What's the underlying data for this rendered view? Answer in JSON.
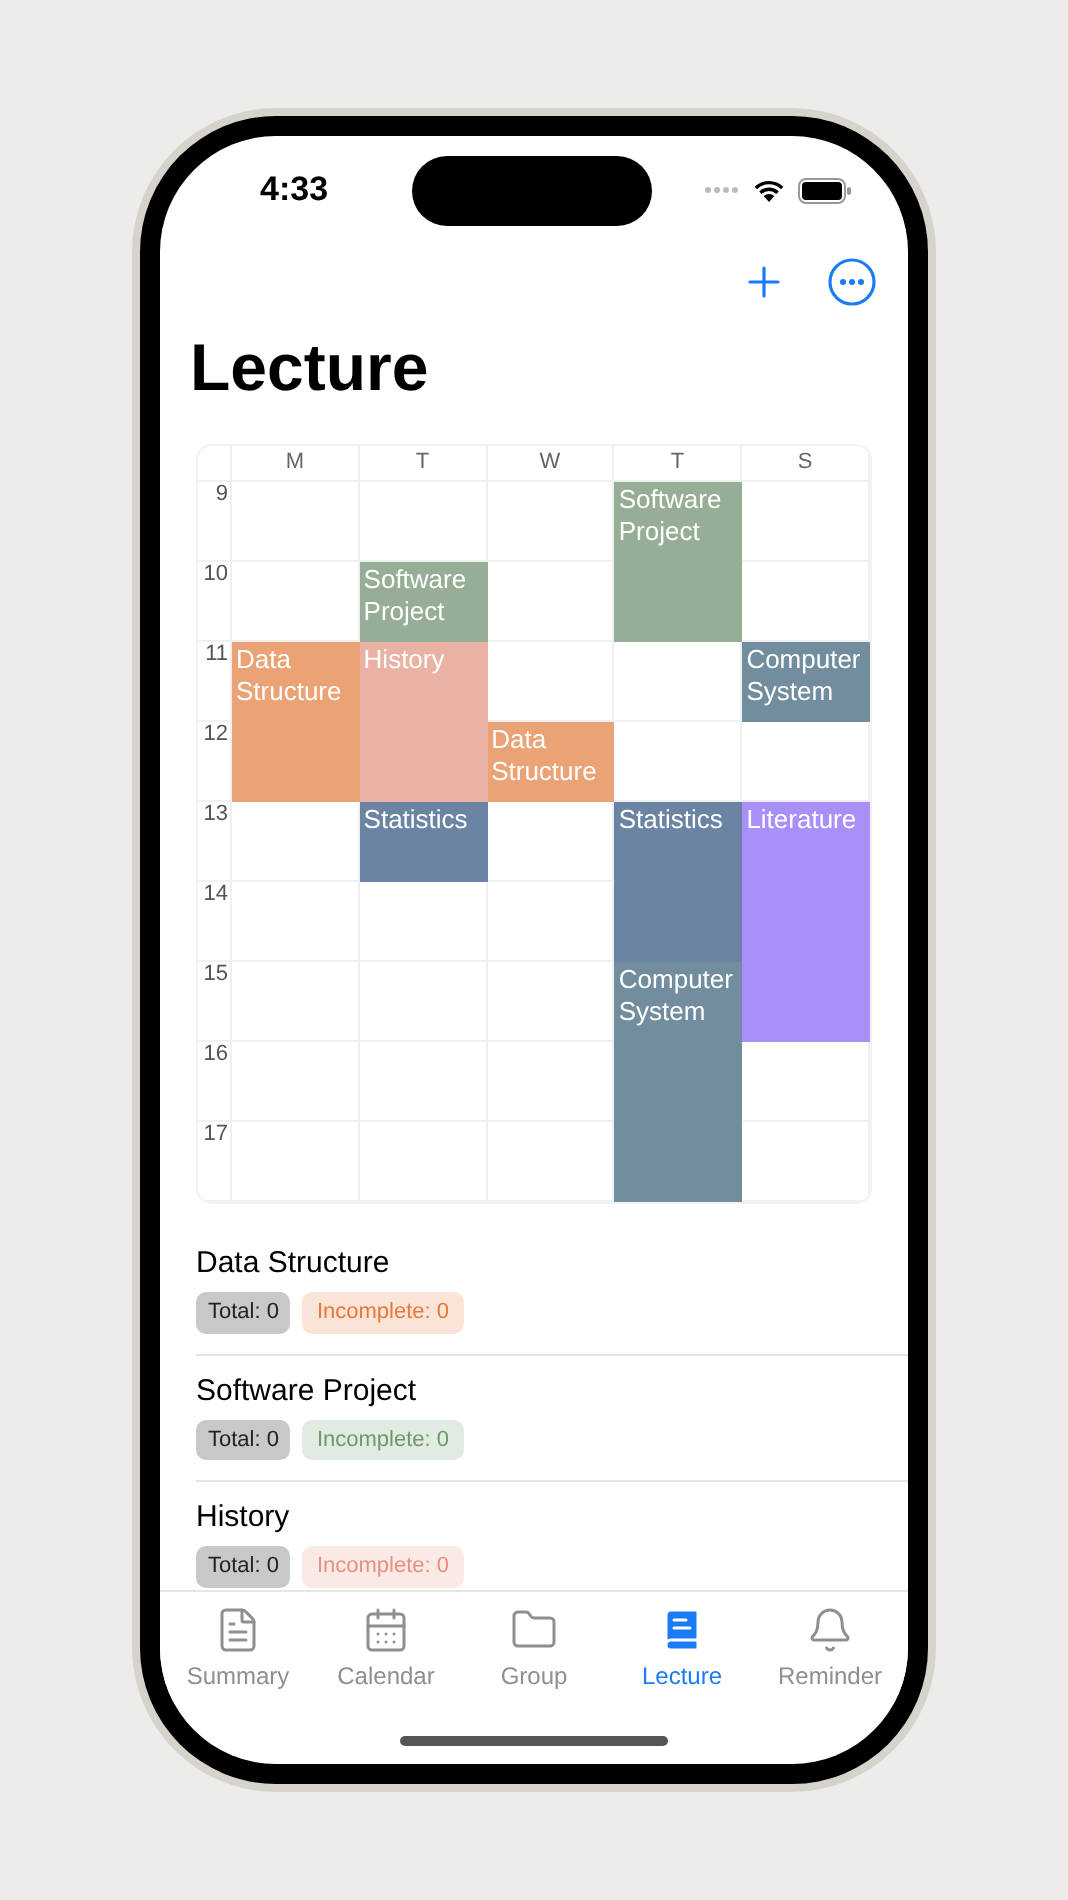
{
  "status_bar": {
    "time": "4:33"
  },
  "title": "Lecture",
  "timetable": {
    "hours": [
      "9",
      "10",
      "11",
      "12",
      "13",
      "14",
      "15",
      "16",
      "17"
    ],
    "days": [
      {
        "label": "M",
        "cells": [
          {
            "kind": "empty"
          },
          {
            "kind": "empty"
          },
          {
            "kind": "lecture",
            "title": "Data Structure",
            "color": "#eba375"
          },
          {
            "kind": "continued"
          },
          {
            "kind": "empty"
          },
          {
            "kind": "empty"
          },
          {
            "kind": "empty"
          },
          {
            "kind": "empty"
          },
          {
            "kind": "empty"
          }
        ]
      },
      {
        "label": "T",
        "cells": [
          {
            "kind": "empty"
          },
          {
            "kind": "lecture",
            "title": "Software Project",
            "color": "#96ae95"
          },
          {
            "kind": "lecture",
            "title": "History",
            "color": "#e9b2a5"
          },
          {
            "kind": "continued"
          },
          {
            "kind": "lecture",
            "title": "Statistics",
            "color": "#6c84a3"
          },
          {
            "kind": "empty"
          },
          {
            "kind": "empty"
          },
          {
            "kind": "empty"
          },
          {
            "kind": "empty"
          }
        ]
      },
      {
        "label": "W",
        "cells": [
          {
            "kind": "empty"
          },
          {
            "kind": "empty"
          },
          {
            "kind": "empty"
          },
          {
            "kind": "lecture",
            "title": "Data Structure",
            "color": "#eba375"
          },
          {
            "kind": "empty"
          },
          {
            "kind": "empty"
          },
          {
            "kind": "empty"
          },
          {
            "kind": "empty"
          },
          {
            "kind": "empty"
          }
        ]
      },
      {
        "label": "T",
        "cells": [
          {
            "kind": "lecture",
            "title": "Software Project",
            "color": "#96ae95"
          },
          {
            "kind": "continued"
          },
          {
            "kind": "empty"
          },
          {
            "kind": "empty"
          },
          {
            "kind": "lecture",
            "title": "Statistics",
            "color": "#6c84a3"
          },
          {
            "kind": "continued"
          },
          {
            "kind": "lecture",
            "title": "Computer System",
            "color": "#718d9e"
          },
          {
            "kind": "continued"
          },
          {
            "kind": "continued"
          }
        ]
      },
      {
        "label": "S",
        "cells": [
          {
            "kind": "empty"
          },
          {
            "kind": "empty"
          },
          {
            "kind": "lecture",
            "title": "Computer System",
            "color": "#718d9e"
          },
          {
            "kind": "empty"
          },
          {
            "kind": "lecture",
            "title": "Literature",
            "color": "#a98ff9"
          },
          {
            "kind": "continued"
          },
          {
            "kind": "continued"
          },
          {
            "kind": "empty"
          },
          {
            "kind": "empty"
          }
        ]
      }
    ]
  },
  "courses": [
    {
      "name": "Data Structure",
      "total": "Total: 0",
      "incomplete": "Incomplete: 0",
      "color": "#e8773a"
    },
    {
      "name": "Software Project",
      "total": "Total: 0",
      "incomplete": "Incomplete: 0",
      "color": "#6a9a6a"
    },
    {
      "name": "History",
      "total": "Total: 0",
      "incomplete": "Incomplete: 0",
      "color": "#e9907e"
    }
  ],
  "tabs": [
    {
      "label": "Summary",
      "kind": "summary",
      "selected": false
    },
    {
      "label": "Calendar",
      "kind": "calendar",
      "selected": false
    },
    {
      "label": "Group",
      "kind": "group",
      "selected": false
    },
    {
      "label": "Lecture",
      "kind": "lecture",
      "selected": true
    },
    {
      "label": "Reminder",
      "kind": "reminder",
      "selected": false
    }
  ]
}
